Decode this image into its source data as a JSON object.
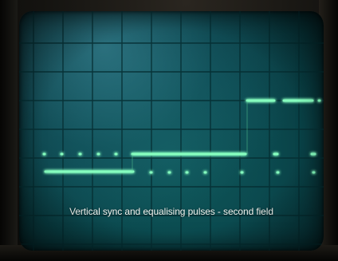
{
  "caption": "Vertical sync and equalising pulses - second field",
  "colors": {
    "screen": "#0b4a4f",
    "trace": "#7dffb8",
    "trace_glow": "#2aff8a",
    "grid": "#062f33"
  }
}
